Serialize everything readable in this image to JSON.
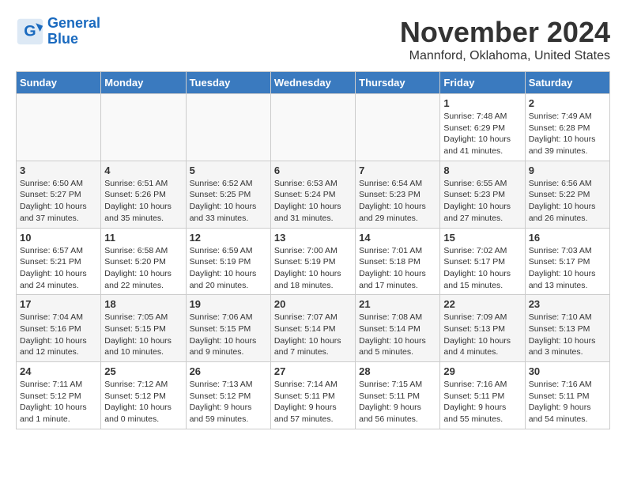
{
  "header": {
    "logo_line1": "General",
    "logo_line2": "Blue",
    "month": "November 2024",
    "location": "Mannford, Oklahoma, United States"
  },
  "days_of_week": [
    "Sunday",
    "Monday",
    "Tuesday",
    "Wednesday",
    "Thursday",
    "Friday",
    "Saturday"
  ],
  "weeks": [
    [
      {
        "day": "",
        "info": ""
      },
      {
        "day": "",
        "info": ""
      },
      {
        "day": "",
        "info": ""
      },
      {
        "day": "",
        "info": ""
      },
      {
        "day": "",
        "info": ""
      },
      {
        "day": "1",
        "info": "Sunrise: 7:48 AM\nSunset: 6:29 PM\nDaylight: 10 hours\nand 41 minutes."
      },
      {
        "day": "2",
        "info": "Sunrise: 7:49 AM\nSunset: 6:28 PM\nDaylight: 10 hours\nand 39 minutes."
      }
    ],
    [
      {
        "day": "3",
        "info": "Sunrise: 6:50 AM\nSunset: 5:27 PM\nDaylight: 10 hours\nand 37 minutes."
      },
      {
        "day": "4",
        "info": "Sunrise: 6:51 AM\nSunset: 5:26 PM\nDaylight: 10 hours\nand 35 minutes."
      },
      {
        "day": "5",
        "info": "Sunrise: 6:52 AM\nSunset: 5:25 PM\nDaylight: 10 hours\nand 33 minutes."
      },
      {
        "day": "6",
        "info": "Sunrise: 6:53 AM\nSunset: 5:24 PM\nDaylight: 10 hours\nand 31 minutes."
      },
      {
        "day": "7",
        "info": "Sunrise: 6:54 AM\nSunset: 5:23 PM\nDaylight: 10 hours\nand 29 minutes."
      },
      {
        "day": "8",
        "info": "Sunrise: 6:55 AM\nSunset: 5:23 PM\nDaylight: 10 hours\nand 27 minutes."
      },
      {
        "day": "9",
        "info": "Sunrise: 6:56 AM\nSunset: 5:22 PM\nDaylight: 10 hours\nand 26 minutes."
      }
    ],
    [
      {
        "day": "10",
        "info": "Sunrise: 6:57 AM\nSunset: 5:21 PM\nDaylight: 10 hours\nand 24 minutes."
      },
      {
        "day": "11",
        "info": "Sunrise: 6:58 AM\nSunset: 5:20 PM\nDaylight: 10 hours\nand 22 minutes."
      },
      {
        "day": "12",
        "info": "Sunrise: 6:59 AM\nSunset: 5:19 PM\nDaylight: 10 hours\nand 20 minutes."
      },
      {
        "day": "13",
        "info": "Sunrise: 7:00 AM\nSunset: 5:19 PM\nDaylight: 10 hours\nand 18 minutes."
      },
      {
        "day": "14",
        "info": "Sunrise: 7:01 AM\nSunset: 5:18 PM\nDaylight: 10 hours\nand 17 minutes."
      },
      {
        "day": "15",
        "info": "Sunrise: 7:02 AM\nSunset: 5:17 PM\nDaylight: 10 hours\nand 15 minutes."
      },
      {
        "day": "16",
        "info": "Sunrise: 7:03 AM\nSunset: 5:17 PM\nDaylight: 10 hours\nand 13 minutes."
      }
    ],
    [
      {
        "day": "17",
        "info": "Sunrise: 7:04 AM\nSunset: 5:16 PM\nDaylight: 10 hours\nand 12 minutes."
      },
      {
        "day": "18",
        "info": "Sunrise: 7:05 AM\nSunset: 5:15 PM\nDaylight: 10 hours\nand 10 minutes."
      },
      {
        "day": "19",
        "info": "Sunrise: 7:06 AM\nSunset: 5:15 PM\nDaylight: 10 hours\nand 9 minutes."
      },
      {
        "day": "20",
        "info": "Sunrise: 7:07 AM\nSunset: 5:14 PM\nDaylight: 10 hours\nand 7 minutes."
      },
      {
        "day": "21",
        "info": "Sunrise: 7:08 AM\nSunset: 5:14 PM\nDaylight: 10 hours\nand 5 minutes."
      },
      {
        "day": "22",
        "info": "Sunrise: 7:09 AM\nSunset: 5:13 PM\nDaylight: 10 hours\nand 4 minutes."
      },
      {
        "day": "23",
        "info": "Sunrise: 7:10 AM\nSunset: 5:13 PM\nDaylight: 10 hours\nand 3 minutes."
      }
    ],
    [
      {
        "day": "24",
        "info": "Sunrise: 7:11 AM\nSunset: 5:12 PM\nDaylight: 10 hours\nand 1 minute."
      },
      {
        "day": "25",
        "info": "Sunrise: 7:12 AM\nSunset: 5:12 PM\nDaylight: 10 hours\nand 0 minutes."
      },
      {
        "day": "26",
        "info": "Sunrise: 7:13 AM\nSunset: 5:12 PM\nDaylight: 9 hours\nand 59 minutes."
      },
      {
        "day": "27",
        "info": "Sunrise: 7:14 AM\nSunset: 5:11 PM\nDaylight: 9 hours\nand 57 minutes."
      },
      {
        "day": "28",
        "info": "Sunrise: 7:15 AM\nSunset: 5:11 PM\nDaylight: 9 hours\nand 56 minutes."
      },
      {
        "day": "29",
        "info": "Sunrise: 7:16 AM\nSunset: 5:11 PM\nDaylight: 9 hours\nand 55 minutes."
      },
      {
        "day": "30",
        "info": "Sunrise: 7:16 AM\nSunset: 5:11 PM\nDaylight: 9 hours\nand 54 minutes."
      }
    ]
  ]
}
